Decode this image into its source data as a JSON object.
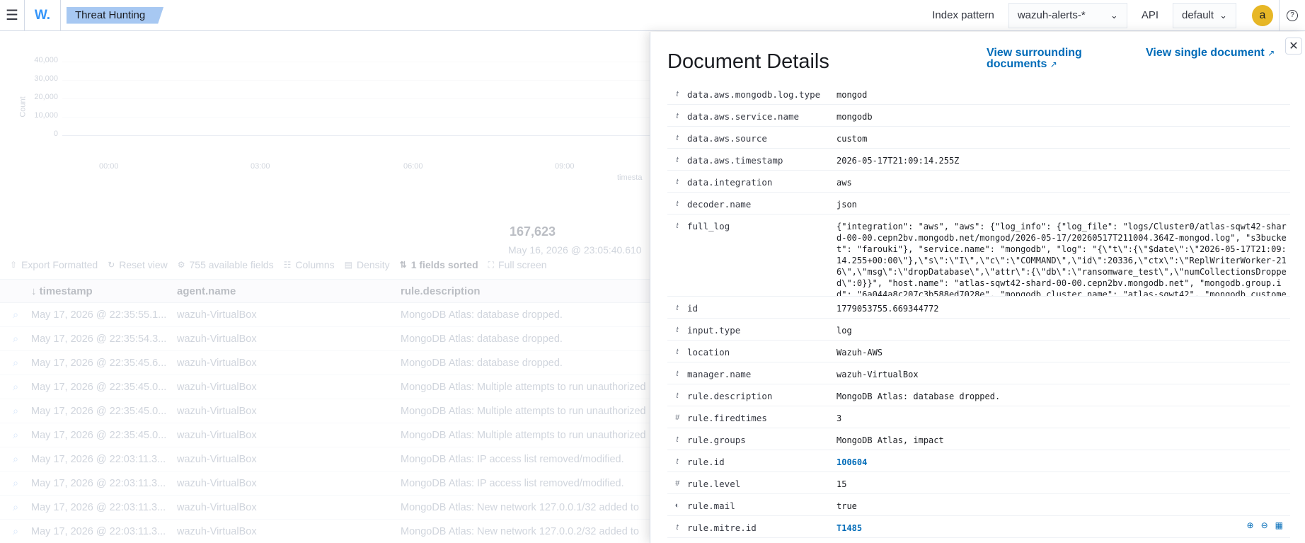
{
  "topbar": {
    "logo": "W.",
    "breadcrumb": "Threat Hunting",
    "index_pattern_label": "Index pattern",
    "index_pattern_value": "wazuh-alerts-*",
    "api_label": "API",
    "api_value": "default",
    "avatar_letter": "a"
  },
  "background": {
    "chart_ylabel": "Count",
    "chart_xlabel": "timesta",
    "yticks": [
      "40,000",
      "30,000",
      "20,000",
      "10,000",
      "0"
    ],
    "xticks": [
      "00:00",
      "03:00",
      "06:00",
      "09:00"
    ],
    "total_hits": "167,623",
    "date_range": "May 16, 2026 @ 23:05:40.610",
    "toolbar": [
      "Export Formatted",
      "Reset view",
      "755 available fields",
      "Columns",
      "Density",
      "1 fields sorted",
      "Full screen"
    ],
    "columns": [
      "timestamp",
      "agent.name",
      "rule.description"
    ],
    "rows": [
      {
        "ts": "May 17, 2026 @ 22:35:55.1...",
        "agent": "wazuh-VirtualBox",
        "desc": "MongoDB Atlas: database dropped."
      },
      {
        "ts": "May 17, 2026 @ 22:35:54.3...",
        "agent": "wazuh-VirtualBox",
        "desc": "MongoDB Atlas: database dropped."
      },
      {
        "ts": "May 17, 2026 @ 22:35:45.6...",
        "agent": "wazuh-VirtualBox",
        "desc": "MongoDB Atlas: database dropped."
      },
      {
        "ts": "May 17, 2026 @ 22:35:45.0...",
        "agent": "wazuh-VirtualBox",
        "desc": "MongoDB Atlas: Multiple attempts to run unauthorized"
      },
      {
        "ts": "May 17, 2026 @ 22:35:45.0...",
        "agent": "wazuh-VirtualBox",
        "desc": "MongoDB Atlas: Multiple attempts to run unauthorized"
      },
      {
        "ts": "May 17, 2026 @ 22:35:45.0...",
        "agent": "wazuh-VirtualBox",
        "desc": "MongoDB Atlas: Multiple attempts to run unauthorized"
      },
      {
        "ts": "May 17, 2026 @ 22:03:11.3...",
        "agent": "wazuh-VirtualBox",
        "desc": "MongoDB Atlas: IP access list removed/modified."
      },
      {
        "ts": "May 17, 2026 @ 22:03:11.3...",
        "agent": "wazuh-VirtualBox",
        "desc": "MongoDB Atlas: IP access list removed/modified."
      },
      {
        "ts": "May 17, 2026 @ 22:03:11.3...",
        "agent": "wazuh-VirtualBox",
        "desc": "MongoDB Atlas: New network 127.0.0.1/32 added to"
      },
      {
        "ts": "May 17, 2026 @ 22:03:11.3...",
        "agent": "wazuh-VirtualBox",
        "desc": "MongoDB Atlas: New network 127.0.0.2/32 added to"
      }
    ]
  },
  "flyout": {
    "title": "Document Details",
    "link_surrounding": "View surrounding documents",
    "link_single": "View single document",
    "fields": [
      {
        "type": "t",
        "name": "data.aws.mongodb.log.type",
        "value": "mongod"
      },
      {
        "type": "t",
        "name": "data.aws.service.name",
        "value": "mongodb"
      },
      {
        "type": "t",
        "name": "data.aws.source",
        "value": "custom"
      },
      {
        "type": "t",
        "name": "data.aws.timestamp",
        "value": "2026-05-17T21:09:14.255Z"
      },
      {
        "type": "t",
        "name": "data.integration",
        "value": "aws"
      },
      {
        "type": "t",
        "name": "decoder.name",
        "value": "json"
      },
      {
        "type": "t",
        "name": "full_log",
        "value": "{\"integration\": \"aws\", \"aws\": {\"log_info\": {\"log_file\": \"logs/Cluster0/atlas-sqwt42-shard-00-00.cepn2bv.mongodb.net/mongod/2026-05-17/20260517T211004.364Z-mongod.log\", \"s3bucket\": \"farouki\"}, \"service.name\": \"mongodb\", \"log\": \"{\\\"t\\\":{\\\"$date\\\":\\\"2026-05-17T21:09:14.255+00:00\\\"},\\\"s\\\":\\\"I\\\",\\\"c\\\":\\\"COMMAND\\\",\\\"id\\\":20336,\\\"ctx\\\":\\\"ReplWriterWorker-216\\\",\\\"msg\\\":\\\"dropDatabase\\\",\\\"attr\\\":{\\\"db\\\":\\\"ransomware_test\\\",\\\"numCollectionsDropped\\\":0}}\", \"host.name\": \"atlas-sqwt42-shard-00-00.cepn2bv.mongodb.net\", \"mongodb.group.id\": \"6a044a8c207c3b588ed7028e\", \"mongodb.cluster.name\": \"atlas-sqwt42\", \"mongodb.customer.clu"
      },
      {
        "type": "t",
        "name": "id",
        "value": "1779053755.669344772"
      },
      {
        "type": "t",
        "name": "input.type",
        "value": "log"
      },
      {
        "type": "t",
        "name": "location",
        "value": "Wazuh-AWS"
      },
      {
        "type": "t",
        "name": "manager.name",
        "value": "wazuh-VirtualBox"
      },
      {
        "type": "t",
        "name": "rule.description",
        "value": "MongoDB Atlas: database dropped."
      },
      {
        "type": "#",
        "name": "rule.firedtimes",
        "value": "3"
      },
      {
        "type": "t",
        "name": "rule.groups",
        "value": "MongoDB Atlas, impact"
      },
      {
        "type": "t",
        "name": "rule.id",
        "value": "100604",
        "link": true
      },
      {
        "type": "#",
        "name": "rule.level",
        "value": "15"
      },
      {
        "type": "◐",
        "name": "rule.mail",
        "value": "true"
      },
      {
        "type": "t",
        "name": "rule.mitre.id",
        "value": "T1485",
        "link": true
      }
    ]
  },
  "colors": {
    "accent": "#006bb8",
    "breadcrumb_bg": "#a7c8f2",
    "avatar_bg": "#e7b726"
  }
}
